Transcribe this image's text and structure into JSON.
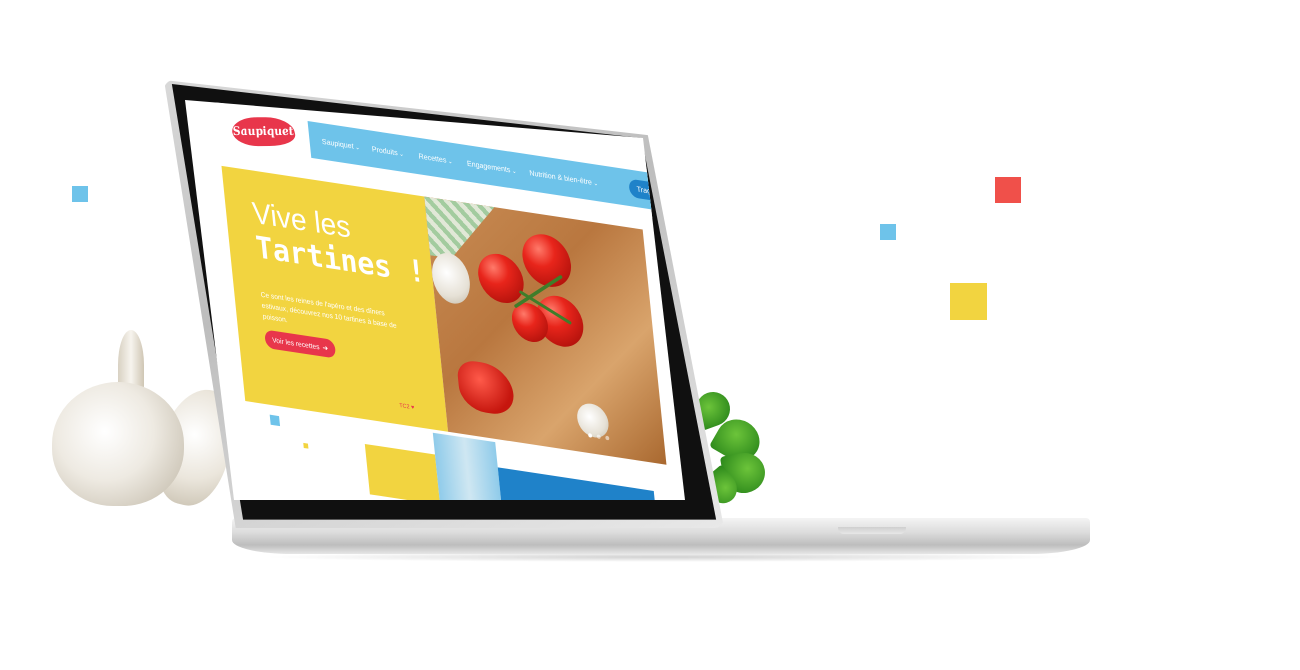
{
  "site": {
    "logo_text": "Saupiquet"
  },
  "nav": {
    "items": [
      {
        "label": "Saupiquet",
        "chev": "⌄"
      },
      {
        "label": "Produits",
        "chev": "⌄"
      },
      {
        "label": "Recettes",
        "chev": "⌄"
      },
      {
        "label": "Engagements",
        "chev": "⌄"
      },
      {
        "label": "Nutrition & bien-être",
        "chev": "⌄"
      }
    ],
    "traceability_label": "Traçabilité",
    "arrow": "➜",
    "search_icon": "⌕"
  },
  "hero": {
    "title_line1": "Vive les",
    "title_line2": "Tartines !",
    "text": "Ce sont les reines de l'apéro et des dîners estivaux, découvrez nos 10 tartines à base de poisson.",
    "button_label": "Voir les recettes",
    "button_arrow": "➜",
    "credit": "TC2 ♥"
  },
  "colors": {
    "brand_red": "#e8364b",
    "nav_blue": "#6ec3ea",
    "button_blue": "#1f82c9",
    "hero_yellow": "#f2d440",
    "square_red": "#f0504a",
    "square_blue": "#6ec3ea",
    "square_yellow": "#f2d440"
  }
}
